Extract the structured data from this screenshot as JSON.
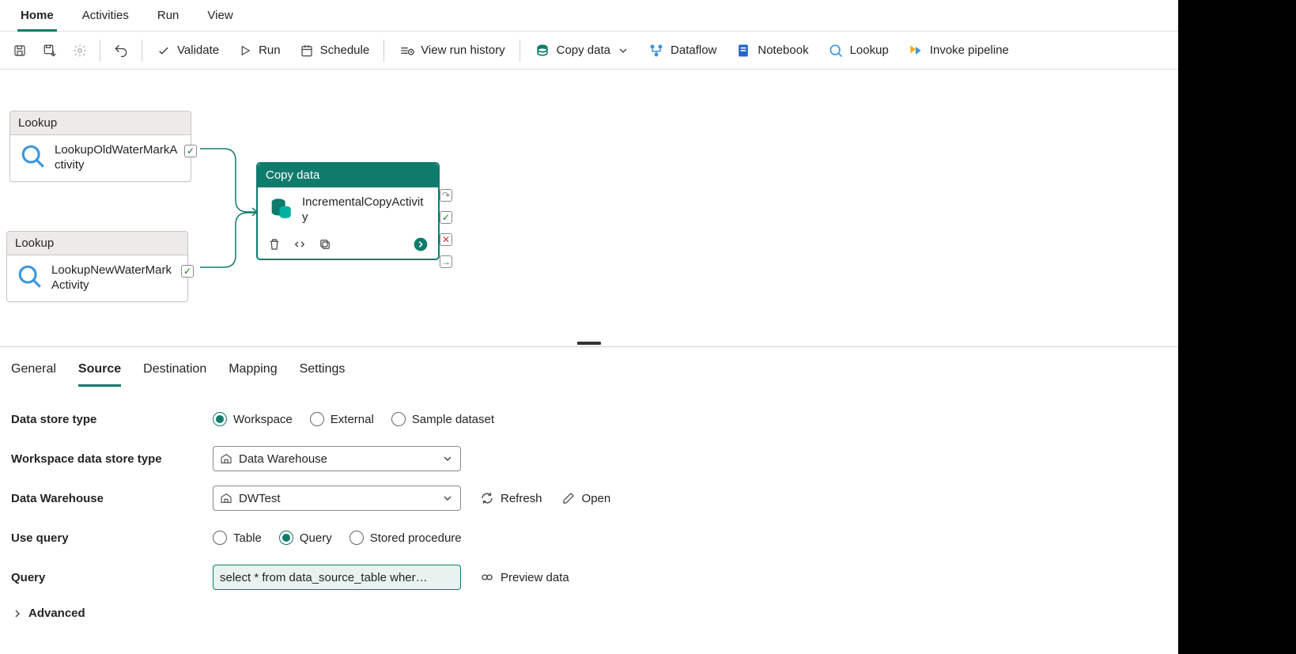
{
  "tabs": {
    "home": "Home",
    "activities": "Activities",
    "run": "Run",
    "view": "View"
  },
  "toolbar": {
    "validate": "Validate",
    "run": "Run",
    "schedule": "Schedule",
    "view_run_history": "View run history",
    "copy_data": "Copy data",
    "dataflow": "Dataflow",
    "notebook": "Notebook",
    "lookup": "Lookup",
    "invoke_pipeline": "Invoke pipeline"
  },
  "nodes": {
    "lookup_label": "Lookup",
    "lookup1_name": "LookupOldWaterMarkActivity",
    "lookup2_name": "LookupNewWaterMarkActivity",
    "copy_label": "Copy data",
    "copy_name": "IncrementalCopyActivity"
  },
  "ptabs": {
    "general": "General",
    "source": "Source",
    "destination": "Destination",
    "mapping": "Mapping",
    "settings": "Settings"
  },
  "form": {
    "data_store_type_label": "Data store type",
    "workspace_radio": "Workspace",
    "external_radio": "External",
    "sample_radio": "Sample dataset",
    "ws_store_type_label": "Workspace data store type",
    "ws_store_type_value": "Data Warehouse",
    "data_warehouse_label": "Data Warehouse",
    "data_warehouse_value": "DWTest",
    "refresh": "Refresh",
    "open": "Open",
    "use_query_label": "Use query",
    "table_radio": "Table",
    "query_radio": "Query",
    "sproc_radio": "Stored procedure",
    "query_label": "Query",
    "query_value": "select * from data_source_table wher…",
    "preview_data": "Preview data",
    "advanced": "Advanced"
  }
}
